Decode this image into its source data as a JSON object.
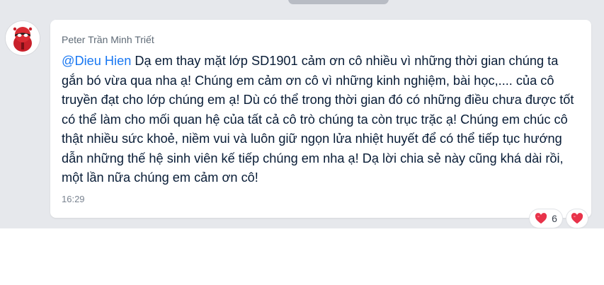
{
  "message": {
    "sender": "Peter Trần Minh Triết",
    "mention": "@Dieu Hien",
    "body": " Dạ em thay mặt lớp SD1901 cảm ơn cô nhiều vì những thời gian chúng ta gắn bó vừa qua nha ạ! Chúng em cảm ơn cô vì những kinh nghiệm, bài học,.... của cô truyền đạt cho lớp chúng em ạ! Dù có thể trong thời gian đó có những điều chưa được tốt có thể làm cho mối quan hệ của tất cả cô trò chúng ta còn trục trặc ạ!  Chúng em chúc cô thật nhiều sức khoẻ, niềm vui và luôn giữ ngọn lửa nhiệt huyết để có thể tiếp tục hướng dẫn những thế hệ sinh viên kế tiếp chúng em nha ạ! Dạ lời chia sẻ này cũng khá dài rồi, một lần nữa chúng em cảm ơn cô!",
    "time": "16:29"
  },
  "reactions": {
    "count": "6",
    "icon": "heart-icon",
    "react_icon": "heart-icon"
  },
  "colors": {
    "mention": "#1877f2",
    "heart": "#e8334a",
    "chat_background": "#e6e8ec"
  }
}
